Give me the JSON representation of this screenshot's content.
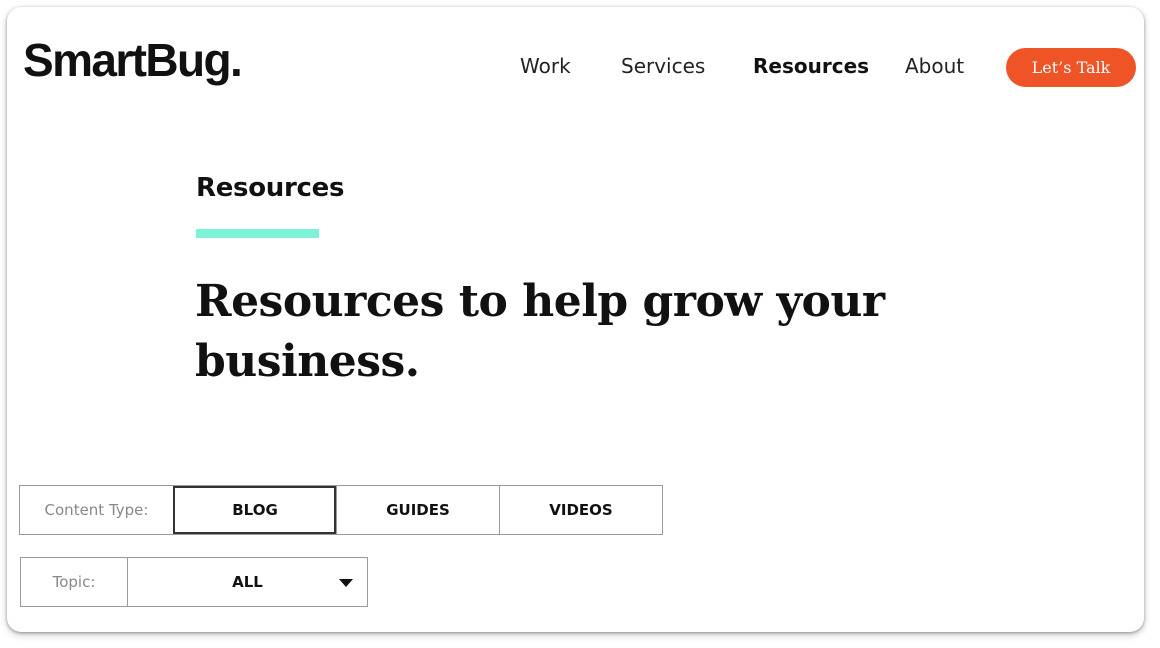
{
  "header": {
    "logo_text": "SmartBug.",
    "nav": [
      {
        "label": "Work",
        "active": false
      },
      {
        "label": "Services",
        "active": false
      },
      {
        "label": "Resources",
        "active": true
      },
      {
        "label": "About",
        "active": false
      }
    ],
    "cta_label": "Let’s Talk"
  },
  "hero": {
    "eyebrow": "Resources",
    "headline": "Resources to help grow your business."
  },
  "filters": {
    "content_type_label": "Content Type:",
    "content_types": [
      {
        "label": "BLOG",
        "selected": true
      },
      {
        "label": "GUIDES",
        "selected": false
      },
      {
        "label": "VIDEOS",
        "selected": false
      }
    ],
    "topic_label": "Topic:",
    "topic_value": "ALL"
  },
  "colors": {
    "accent": "#7cf2d9",
    "cta": "#ef5427"
  }
}
